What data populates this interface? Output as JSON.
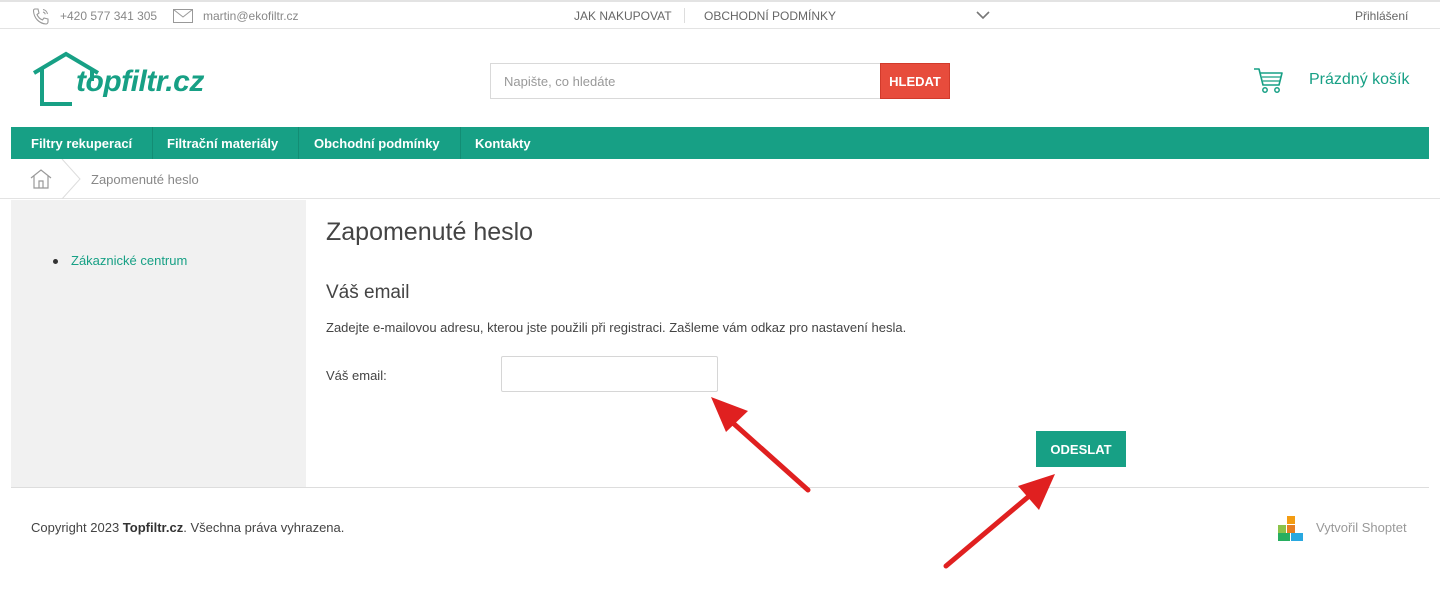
{
  "topbar": {
    "phone": "+420 577 341 305",
    "email": "martin@ekofiltr.cz",
    "nav": [
      "JAK NAKUPOVAT",
      "OBCHODNÍ PODMÍNKY"
    ],
    "login": "Přihlášení"
  },
  "header": {
    "logo_text": "topfiltr.cz",
    "search_placeholder": "Napište, co hledáte",
    "search_button": "HLEDAT",
    "cart_label": "Prázdný košík"
  },
  "mainnav": [
    "Filtry rekuperací",
    "Filtrační materiály",
    "Obchodní podmínky",
    "Kontakty"
  ],
  "breadcrumb": {
    "current": "Zapomenuté heslo"
  },
  "sidebar": {
    "items": [
      "Zákaznické centrum"
    ]
  },
  "content": {
    "page_title": "Zapomenuté heslo",
    "section_title": "Váš email",
    "description": "Zadejte e-mailovou adresu, kterou jste použili při registraci. Zašleme vám odkaz pro nastavení hesla.",
    "field_label": "Váš email:",
    "email_value": "",
    "submit_label": "ODESLAT"
  },
  "footer": {
    "copyright_prefix": "Copyright 2023 ",
    "copyright_brand": "Topfiltr.cz",
    "copyright_suffix": ". Všechna práva vyhrazena.",
    "shoptet_label": "Vytvořil Shoptet"
  },
  "colors": {
    "accent": "#17a085",
    "search_button": "#e74c3c",
    "annotation_arrow": "#e02020"
  }
}
